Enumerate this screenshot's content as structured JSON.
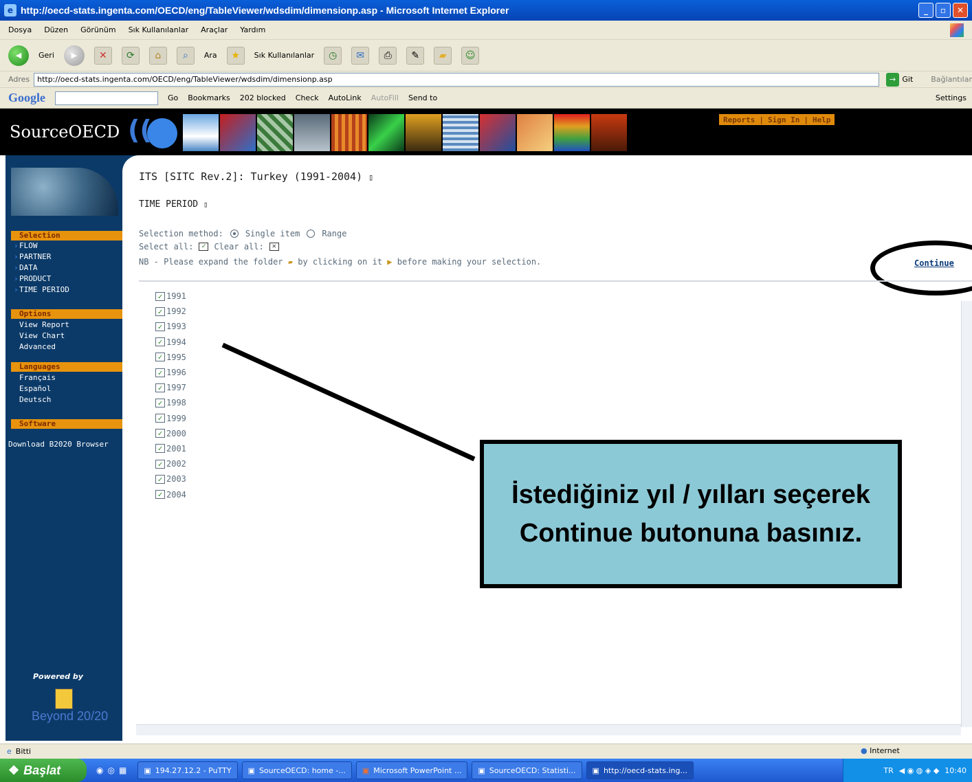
{
  "window": {
    "title": "http://oecd-stats.ingenta.com/OECD/eng/TableViewer/wdsdim/dimensionp.asp - Microsoft Internet Explorer"
  },
  "menu": [
    "Dosya",
    "Düzen",
    "Görünüm",
    "Sık Kullanılanlar",
    "Araçlar",
    "Yardım"
  ],
  "toolbar": {
    "back_label": "Geri",
    "search_label": "Ara",
    "favorites_label": "Sık Kullanılanlar"
  },
  "address": {
    "label": "Adres",
    "url": "http://oecd-stats.ingenta.com/OECD/eng/TableViewer/wdsdim/dimensionp.asp",
    "go_label": "Git",
    "links_label": "Bağlantılar"
  },
  "google": {
    "logo": "Google",
    "go_label": "Go",
    "bookmarks": "Bookmarks",
    "blocked": "202 blocked",
    "check": "Check",
    "autolink": "AutoLink",
    "autofill": "AutoFill",
    "send_to": "Send to",
    "settings": "Settings"
  },
  "banner": {
    "brand": "SourceOECD",
    "links": [
      "Reports",
      "Sign In",
      "Help"
    ]
  },
  "sidebar": {
    "selection_head": "Selection",
    "selection_items": [
      "FLOW",
      "PARTNER",
      "DATA",
      "PRODUCT",
      "TIME PERIOD"
    ],
    "options_head": "Options",
    "options_items": [
      "View Report",
      "View Chart",
      "Advanced"
    ],
    "languages_head": "Languages",
    "languages_items": [
      "Français",
      "Español",
      "Deutsch"
    ],
    "software_head": "Software",
    "download": "Download B2020 Browser",
    "powered_by": "Powered by",
    "beyond": "Beyond 20/20"
  },
  "main": {
    "report_title": "ITS [SITC Rev.2]: Turkey (1991-2004)",
    "section_title": "TIME PERIOD",
    "selection_method_label": "Selection method:",
    "single_item_label": "Single item",
    "range_label": "Range",
    "select_all_label": "Select all:",
    "clear_all_label": "Clear all:",
    "note_part1": "NB - Please expand the folder",
    "note_part2": "by clicking on it",
    "note_part3": "before making your selection.",
    "continue_label": "Continue",
    "years": [
      "1991",
      "1992",
      "1993",
      "1994",
      "1995",
      "1996",
      "1997",
      "1998",
      "1999",
      "2000",
      "2001",
      "2002",
      "2003",
      "2004"
    ]
  },
  "callout": {
    "text": "İstediğiniz yıl / yılları seçerek Continue butonuna basınız."
  },
  "status": {
    "left": "Bitti",
    "zone": "Internet"
  },
  "taskbar": {
    "start": "Başlat",
    "tasks": [
      "194.27.12.2 - PuTTY",
      "SourceOECD: home -...",
      "Microsoft PowerPoint ...",
      "SourceOECD: Statisti...",
      "http://oecd-stats.ing..."
    ],
    "tray_lang": "TR",
    "clock": "10:40"
  }
}
